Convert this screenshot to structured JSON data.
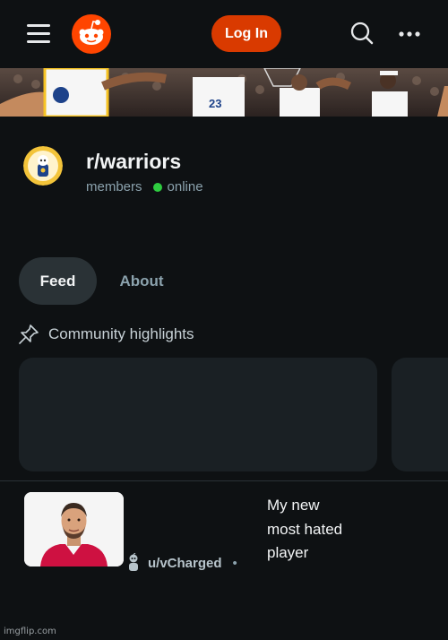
{
  "header": {
    "menu_icon": "hamburger-icon",
    "logo_icon": "reddit-snoo-logo",
    "login_label": "Log In",
    "search_icon": "search-icon",
    "more_icon": "more-horizontal-icon",
    "accent_color": "#d93a00"
  },
  "community": {
    "name": "r/warriors",
    "members_label": "members",
    "online_label": "online",
    "online_color": "#2ecc40"
  },
  "tabs": [
    {
      "label": "Feed",
      "active": true
    },
    {
      "label": "About",
      "active": false
    }
  ],
  "highlights": {
    "icon": "pin-icon",
    "title": "Community highlights"
  },
  "post": {
    "username": "u/vCharged",
    "separator": "•",
    "title": "My new most hated player"
  },
  "watermark": "imgflip.com"
}
